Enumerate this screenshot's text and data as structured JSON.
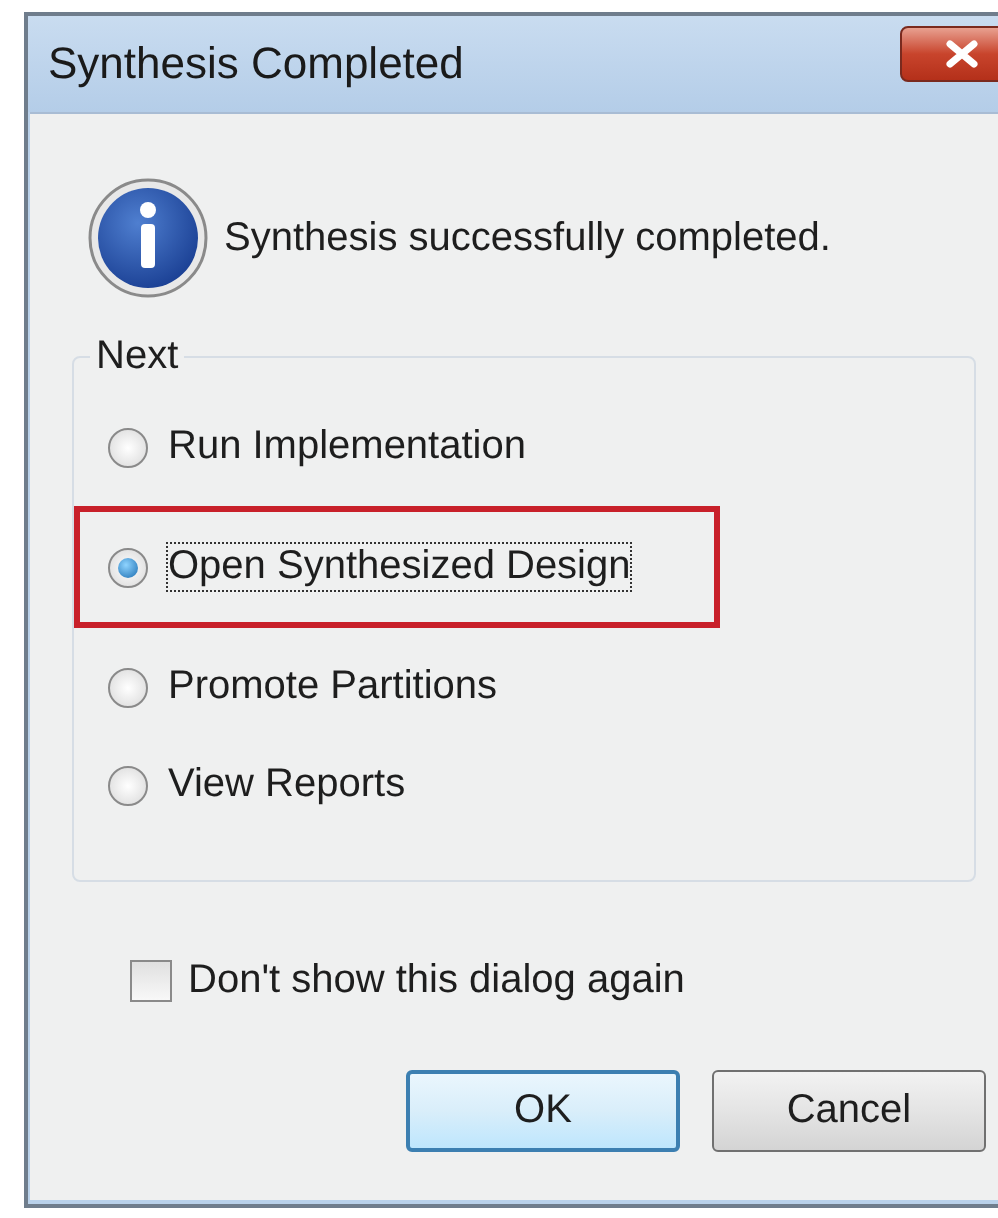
{
  "window": {
    "title": "Synthesis Completed"
  },
  "message": "Synthesis successfully completed.",
  "group": {
    "title": "Next",
    "options": [
      {
        "label": "Run Implementation",
        "selected": false,
        "highlighted": false
      },
      {
        "label": "Open Synthesized Design",
        "selected": true,
        "highlighted": true
      },
      {
        "label": "Promote Partitions",
        "selected": false,
        "highlighted": false
      },
      {
        "label": "View Reports",
        "selected": false,
        "highlighted": false
      }
    ]
  },
  "checkbox": {
    "label": "Don't show this dialog again",
    "checked": false
  },
  "buttons": [
    {
      "label": "OK",
      "default": true
    },
    {
      "label": "Cancel",
      "default": false
    }
  ]
}
